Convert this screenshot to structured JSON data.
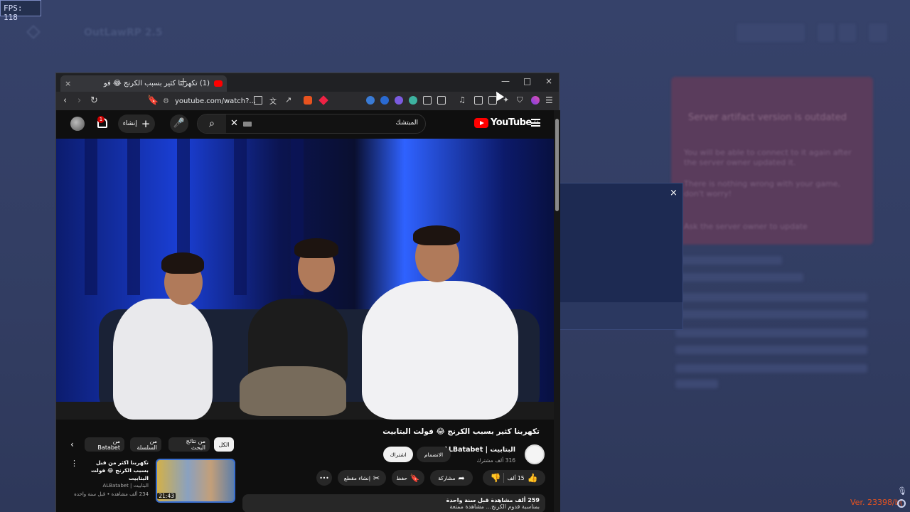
{
  "overlay": {
    "fps": "FPS: 118",
    "version": "Ver. 23398/b("
  },
  "background_app": {
    "title": "OutLawRP 2.5",
    "notice_title": "Server artifact version is outdated",
    "notice_lines": [
      "You will be able to connect to it again after",
      "the server owner updated it.",
      "",
      "There is nothing wrong with your game,",
      "don't worry!"
    ],
    "notice_link": "Ask the server owner to update"
  },
  "modal": {
    "close_label": "×"
  },
  "browser": {
    "tab_title": "(1) تكهربنا كثير بسبب الكرنج 😂 فو",
    "tab_close": "×",
    "new_tab": "+",
    "win_min": "—",
    "win_max": "□",
    "win_close": "×",
    "url": "youtube.com/watch?..."
  },
  "youtube": {
    "create_label": "إنشاء",
    "notification_count": "1",
    "search_text": "المبتشك",
    "logo_text": "YouTube",
    "logo_region": "SA",
    "video": {
      "title": "تكهربنا كثير بسبب الكرنج 😂 فولت البتابيت",
      "channel_name": "البتابيت | ALBatabet",
      "subscribers": "316 ألف مشترك",
      "join_label": "الانضمام",
      "subscribe_label": "اشتراك",
      "likes": "15 ألف",
      "share_label": "مشاركة",
      "save_label": "حفظ",
      "clip_label": "إنشاء مقطع",
      "more_label": "•••",
      "views_line": "259 ألف مشاهدة  قبل سنة واحدة",
      "desc_line": "بمناسبة قدوم الكرنج... مشاهدة ممتعة"
    },
    "chips": [
      {
        "label": "الكل"
      },
      {
        "label": "من نتائج البحث"
      },
      {
        "label": "من السلسلة"
      },
      {
        "label": "من Batabet"
      }
    ],
    "recommendation": {
      "title": "تكهربنا اكثر من قبل بسبب الكرنج 😂 فولت البتابيت",
      "channel": "البتابيت | ALBatabet",
      "meta": "234 ألف مشاهدة • قبل سنة واحدة",
      "duration": "21:43"
    }
  }
}
